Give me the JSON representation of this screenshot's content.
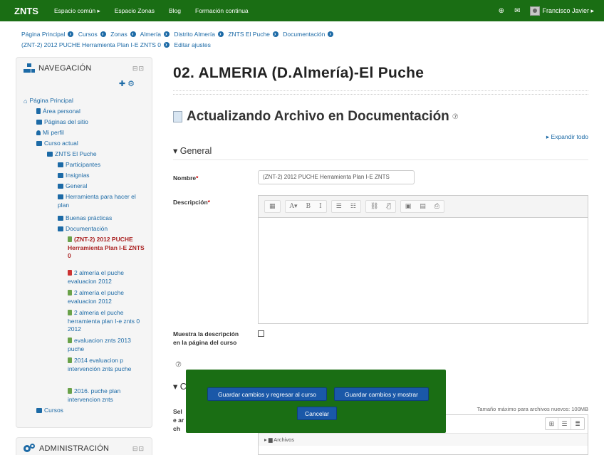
{
  "topbar": {
    "brand": "ZNTS",
    "nav": [
      "Espacio común ▸",
      "Espacio Zonas",
      "Blog",
      "Formación continua"
    ],
    "user": "Francisco Javier ▸",
    "icons": [
      "globe-icon",
      "mail-icon"
    ]
  },
  "breadcrumb": {
    "items": [
      "Página Principal",
      "Cursos",
      "Zonas",
      "Almería",
      "Distrito Almería",
      "ZNTS El Puche",
      "Documentación",
      "(ZNT-2) 2012 PUCHE Herramienta Plan I-E ZNTS 0",
      "Editar ajustes"
    ]
  },
  "navigation_block": {
    "title": "NAVEGACIÓN",
    "controls": "⊟⊡",
    "actions": "✚ ⚙",
    "items": [
      {
        "label": "Página Principal",
        "icon": "home"
      },
      {
        "label": "Área personal",
        "icon": "page"
      },
      {
        "label": "Páginas del sitio",
        "icon": "folder"
      },
      {
        "label": "Mi perfil",
        "icon": "person"
      },
      {
        "label": "Curso actual",
        "icon": "folder"
      },
      {
        "label": "ZNTS El Puche",
        "icon": "folder"
      },
      {
        "label": "Participantes",
        "icon": "folder"
      },
      {
        "label": "Insignias",
        "icon": "folder"
      },
      {
        "label": "General",
        "icon": "folder"
      },
      {
        "label": "Herramienta para hacer el plan",
        "icon": "folder"
      },
      {
        "label": "Buenas prácticas",
        "icon": "folder"
      },
      {
        "label": "Documentación",
        "icon": "folder"
      },
      {
        "label": "(ZNT-2) 2012 PUCHE Herramienta Plan I-E ZNTS 0",
        "icon": "file"
      },
      {
        "label": "2 almería el puche evaluacion 2012",
        "icon": "pdf"
      },
      {
        "label": "2 almería el puche evaluacion 2012",
        "icon": "file"
      },
      {
        "label": "2 almeria el puche herramienta plan I-e znts 0 2012",
        "icon": "file"
      },
      {
        "label": "evaluacion znts 2013 puche",
        "icon": "file"
      },
      {
        "label": "2014 evaluacion p intervención znts puche",
        "icon": "file"
      },
      {
        "label": "2016. puche plan intervencion znts",
        "icon": "file"
      },
      {
        "label": "Cursos",
        "icon": "folder"
      }
    ]
  },
  "admin_block": {
    "title": "ADMINISTRACIÓN",
    "controls": "⊟⊡"
  },
  "main": {
    "course_title": "02. ALMERIA (D.Almería)-El Puche",
    "heading": "Actualizando Archivo en Documentación",
    "help": "⑦",
    "expand_all": "▸ Expandir todo",
    "section_general": "▾ General",
    "name_label": "Nombre",
    "required_mark": "*",
    "name_value": "(ZNT-2) 2012 PUCHE Herramienta Plan I-E ZNTS",
    "description_label": "Descripción",
    "show_description_label": "Muestra la descripción en la página del curso",
    "toolbar_buttons": [
      "▦",
      "A▾",
      "B",
      "I",
      "☰",
      "☷",
      "⛓",
      "⛓̸",
      "▣",
      "▤",
      "⎙"
    ],
    "section_content_partial": "▾ C",
    "select_files_partial": "Sele arch",
    "max_size": "Tamaño máximo para archivos nuevos: 100MB",
    "file_views": [
      "⊞",
      "☰",
      "≣"
    ],
    "files_path": "▸ ▆ Archivos"
  },
  "overlay": {
    "save_return": "Guardar cambios y regresar al curso",
    "save_show": "Guardar cambios y mostrar",
    "cancel": "Cancelar"
  }
}
